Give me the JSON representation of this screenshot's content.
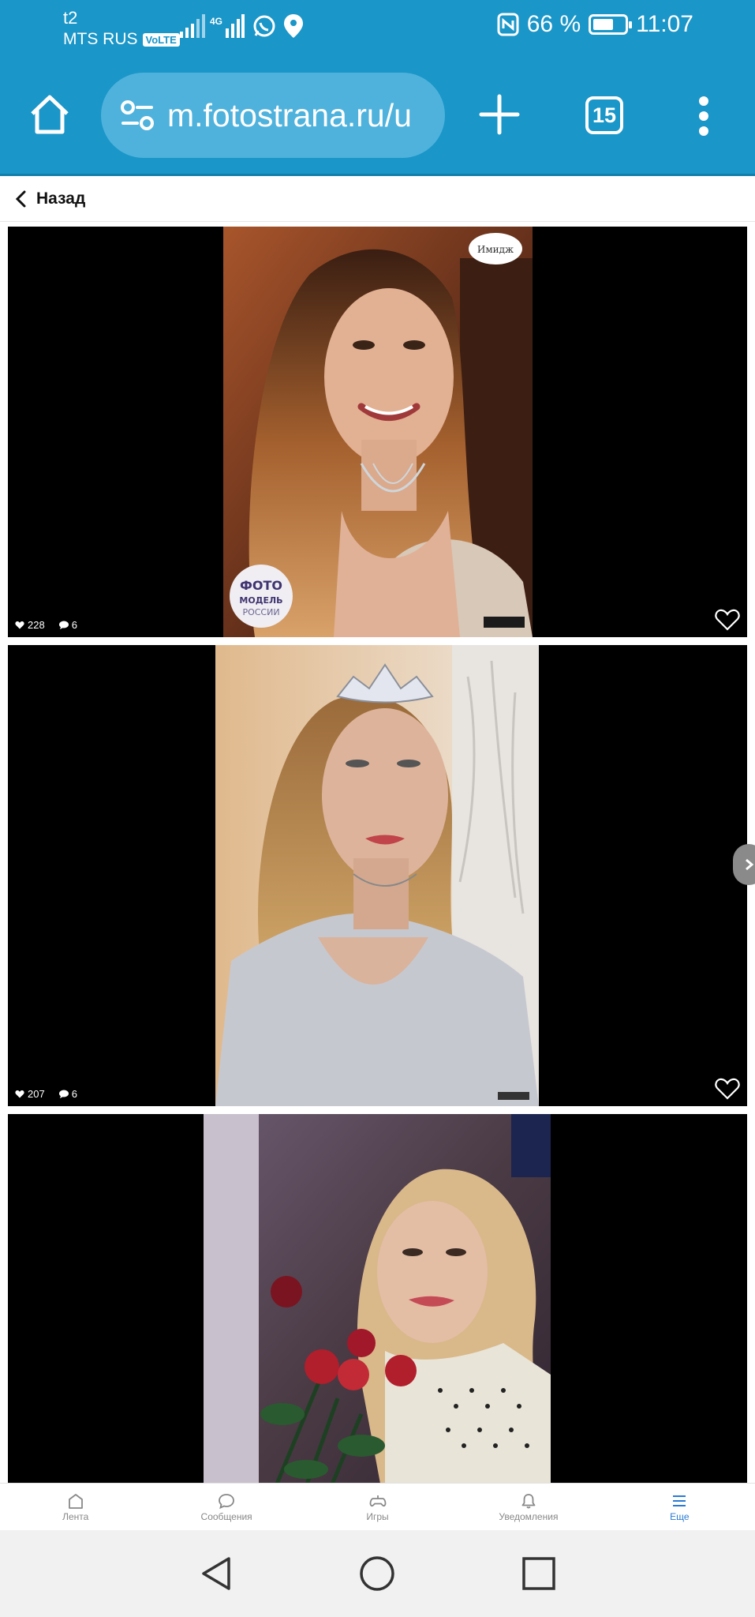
{
  "status_bar": {
    "carrier_top": "t2",
    "carrier": "MTS RUS",
    "volte": "VoLTE",
    "network": "4G",
    "battery_percent": "66 %",
    "battery_level": 0.66,
    "time": "11:07"
  },
  "browser": {
    "url": "m.fotostrana.ru/u",
    "tab_count": "15",
    "icons": [
      "home-icon",
      "site-settings-icon",
      "plus-icon",
      "tabs-icon",
      "more-vert-icon"
    ]
  },
  "backbar": {
    "label": "Назад"
  },
  "photos": [
    {
      "likes": "228",
      "comments": "6"
    },
    {
      "likes": "207",
      "comments": "6"
    },
    {
      "likes": "",
      "comments": ""
    }
  ],
  "bottom_nav": [
    {
      "label": "Лента",
      "icon": "home-icon"
    },
    {
      "label": "Сообщения",
      "icon": "chat-icon"
    },
    {
      "label": "Игры",
      "icon": "gamepad-icon"
    },
    {
      "label": "Уведомления",
      "icon": "bell-icon"
    },
    {
      "label": "Еще",
      "icon": "menu-icon",
      "active": true
    }
  ],
  "colors": {
    "chrome": "#1a96c8",
    "active_nav": "#2a7ad5"
  }
}
